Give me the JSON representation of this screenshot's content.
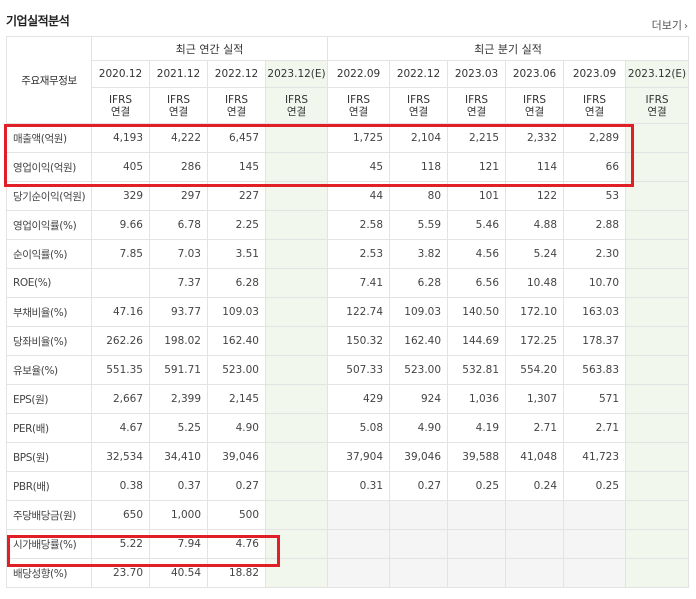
{
  "title": "기업실적분석",
  "more_link": "더보기",
  "header": {
    "row_label": "주요재무정보",
    "annual_group": "최근 연간 실적",
    "quarter_group": "최근 분기 실적",
    "annual_dates": [
      "2020.12",
      "2021.12",
      "2022.12",
      "2023.12(E)"
    ],
    "quarter_dates": [
      "2022.09",
      "2022.12",
      "2023.03",
      "2023.06",
      "2023.09",
      "2023.12(E)"
    ],
    "ifrs_line1": "IFRS",
    "ifrs_line2": "연결"
  },
  "rows": [
    {
      "label": "매출액(억원)",
      "annual": [
        "4,193",
        "4,222",
        "6,457",
        ""
      ],
      "quarter": [
        "1,725",
        "2,104",
        "2,215",
        "2,332",
        "2,289",
        ""
      ]
    },
    {
      "label": "영업이익(억원)",
      "annual": [
        "405",
        "286",
        "145",
        ""
      ],
      "quarter": [
        "45",
        "118",
        "121",
        "114",
        "66",
        ""
      ]
    },
    {
      "label": "당기순이익(억원)",
      "annual": [
        "329",
        "297",
        "227",
        ""
      ],
      "quarter": [
        "44",
        "80",
        "101",
        "122",
        "53",
        ""
      ]
    },
    {
      "label": "영업이익률(%)",
      "annual": [
        "9.66",
        "6.78",
        "2.25",
        ""
      ],
      "quarter": [
        "2.58",
        "5.59",
        "5.46",
        "4.88",
        "2.88",
        ""
      ]
    },
    {
      "label": "순이익률(%)",
      "annual": [
        "7.85",
        "7.03",
        "3.51",
        ""
      ],
      "quarter": [
        "2.53",
        "3.82",
        "4.56",
        "5.24",
        "2.30",
        ""
      ]
    },
    {
      "label": "ROE(%)",
      "annual": [
        "",
        "7.37",
        "6.28",
        ""
      ],
      "quarter": [
        "7.41",
        "6.28",
        "6.56",
        "10.48",
        "10.70",
        ""
      ]
    },
    {
      "label": "부채비율(%)",
      "annual": [
        "47.16",
        "93.77",
        "109.03",
        ""
      ],
      "quarter": [
        "122.74",
        "109.03",
        "140.50",
        "172.10",
        "163.03",
        ""
      ]
    },
    {
      "label": "당좌비율(%)",
      "annual": [
        "262.26",
        "198.02",
        "162.40",
        ""
      ],
      "quarter": [
        "150.32",
        "162.40",
        "144.69",
        "172.25",
        "178.37",
        ""
      ]
    },
    {
      "label": "유보율(%)",
      "annual": [
        "551.35",
        "591.71",
        "523.00",
        ""
      ],
      "quarter": [
        "507.33",
        "523.00",
        "532.81",
        "554.20",
        "563.83",
        ""
      ]
    },
    {
      "label": "EPS(원)",
      "annual": [
        "2,667",
        "2,399",
        "2,145",
        ""
      ],
      "quarter": [
        "429",
        "924",
        "1,036",
        "1,307",
        "571",
        ""
      ]
    },
    {
      "label": "PER(배)",
      "annual": [
        "4.67",
        "5.25",
        "4.90",
        ""
      ],
      "quarter": [
        "5.08",
        "4.90",
        "4.19",
        "2.71",
        "2.71",
        ""
      ]
    },
    {
      "label": "BPS(원)",
      "annual": [
        "32,534",
        "34,410",
        "39,046",
        ""
      ],
      "quarter": [
        "37,904",
        "39,046",
        "39,588",
        "41,048",
        "41,723",
        ""
      ]
    },
    {
      "label": "PBR(배)",
      "annual": [
        "0.38",
        "0.37",
        "0.27",
        ""
      ],
      "quarter": [
        "0.31",
        "0.27",
        "0.25",
        "0.24",
        "0.25",
        ""
      ]
    },
    {
      "label": "주당배당금(원)",
      "annual": [
        "650",
        "1,000",
        "500",
        ""
      ],
      "quarter": [
        "",
        "",
        "",
        "",
        "",
        ""
      ]
    },
    {
      "label": "시가배당률(%)",
      "annual": [
        "5.22",
        "7.94",
        "4.76",
        ""
      ],
      "quarter": [
        "",
        "",
        "",
        "",
        "",
        ""
      ]
    },
    {
      "label": "배당성향(%)",
      "annual": [
        "23.70",
        "40.54",
        "18.82",
        ""
      ],
      "quarter": [
        "",
        "",
        "",
        "",
        "",
        ""
      ]
    }
  ],
  "highlight_color": "#e01f26"
}
